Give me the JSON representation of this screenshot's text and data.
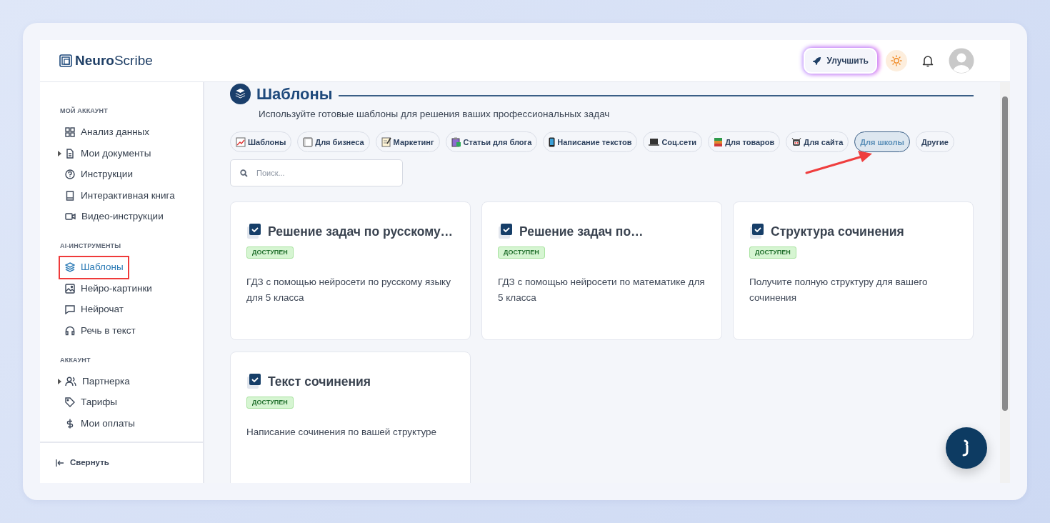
{
  "header": {
    "logo_bold": "Neuro",
    "logo_light": "Scribe",
    "upgrade_button": "Улучшить"
  },
  "sidebar": {
    "sections": [
      {
        "heading": "МОЙ АККАУНТ",
        "items": [
          {
            "label": "Анализ данных",
            "expandable": false,
            "selected": false
          },
          {
            "label": "Мои документы",
            "expandable": true,
            "selected": false
          },
          {
            "label": "Инструкции",
            "expandable": false,
            "selected": false
          },
          {
            "label": "Интерактивная книга",
            "expandable": false,
            "selected": false
          },
          {
            "label": "Видео-инструкции",
            "expandable": false,
            "selected": false
          }
        ]
      },
      {
        "heading": "AI-ИНСТРУМЕНТЫ",
        "items": [
          {
            "label": "Шаблоны",
            "expandable": false,
            "selected": true
          },
          {
            "label": "Нейро-картинки",
            "expandable": false,
            "selected": false
          },
          {
            "label": "Нейрочат",
            "expandable": false,
            "selected": false
          },
          {
            "label": "Речь в текст",
            "expandable": false,
            "selected": false
          }
        ]
      },
      {
        "heading": "АККАУНТ",
        "items": [
          {
            "label": "Партнерка",
            "expandable": true,
            "selected": false
          },
          {
            "label": "Тарифы",
            "expandable": false,
            "selected": false
          },
          {
            "label": "Мои оплаты",
            "expandable": false,
            "selected": false
          }
        ]
      }
    ],
    "collapse_button": "Свернуть"
  },
  "page": {
    "title": "Шаблоны",
    "subtitle": "Используйте готовые шаблоны для решения ваших профессиональных задач"
  },
  "filters": [
    {
      "label": "Шаблоны",
      "selected": false
    },
    {
      "label": "Для бизнеса",
      "selected": false
    },
    {
      "label": "Маркетинг",
      "selected": false
    },
    {
      "label": "Статьи для блога",
      "selected": false
    },
    {
      "label": "Написание текстов",
      "selected": false
    },
    {
      "label": "Соц.сети",
      "selected": false
    },
    {
      "label": "Для товаров",
      "selected": false
    },
    {
      "label": "Для сайта",
      "selected": false
    },
    {
      "label": "Для школы",
      "selected": true
    },
    {
      "label": "Другие",
      "selected": false
    }
  ],
  "search": {
    "placeholder": "Поиск..."
  },
  "cards": [
    {
      "title": "Решение задач по русскому…",
      "status": "ДОСТУПЕН",
      "description": "ГДЗ с помощью нейросети по русскому языку для 5 класса"
    },
    {
      "title": "Решение задач по…",
      "status": "ДОСТУПЕН",
      "description": "ГДЗ с помощью нейросети по математике для 5 класса"
    },
    {
      "title": "Структура сочинения",
      "status": "ДОСТУПЕН",
      "description": "Получите полную структуру для вашего сочинения"
    },
    {
      "title": "Текст сочинения",
      "status": "ДОСТУПЕН",
      "description": "Написание сочинения по вашей структуре"
    }
  ]
}
